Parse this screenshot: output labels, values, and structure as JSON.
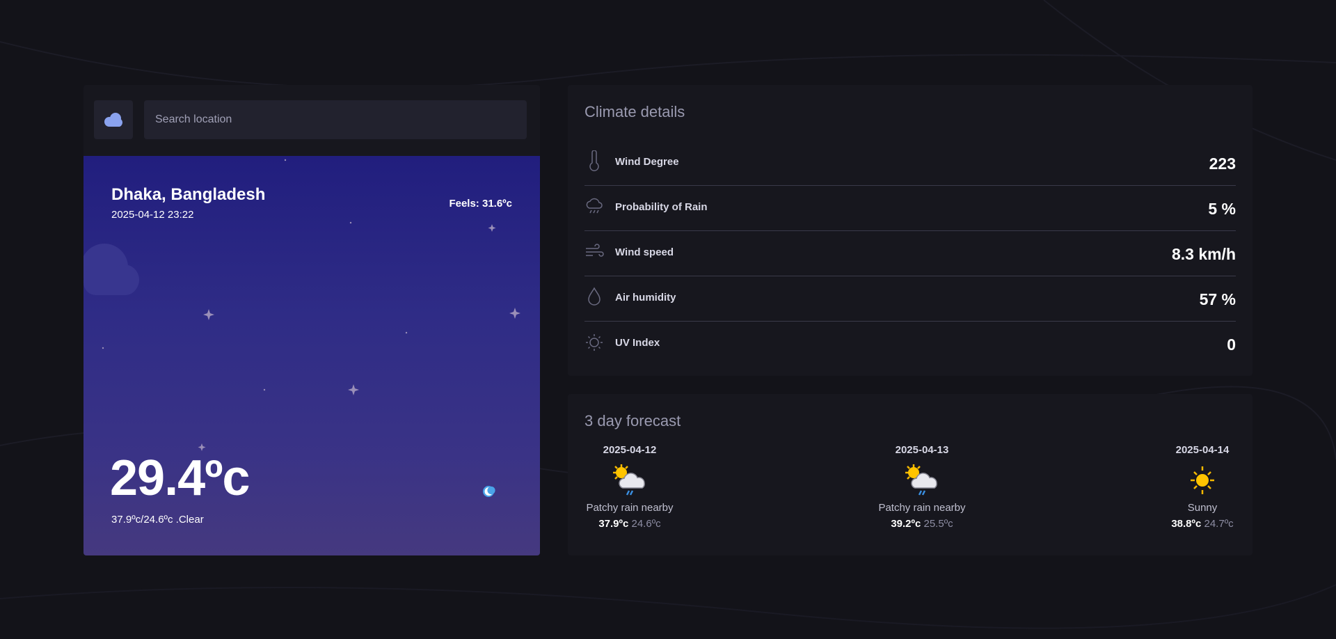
{
  "search": {
    "placeholder": "Search location",
    "logo_icon": "cloud-icon"
  },
  "current": {
    "city": "Dhaka, Bangladesh",
    "datetime": "2025-04-12 23:22",
    "feels": "Feels: 31.6ºc",
    "temp": "29.4ºc",
    "range": "37.9ºc/24.6ºc .Clear",
    "icon": "moon-icon"
  },
  "climate": {
    "title": "Climate details",
    "items": [
      {
        "label": "Wind Degree",
        "value": "223",
        "icon": "thermometer-icon"
      },
      {
        "label": "Probability of Rain",
        "value": "5 %",
        "icon": "rain-cloud-icon"
      },
      {
        "label": "Wind speed",
        "value": "8.3 km/h",
        "icon": "wind-icon"
      },
      {
        "label": "Air humidity",
        "value": "57 %",
        "icon": "droplet-icon"
      },
      {
        "label": "UV Index",
        "value": "0",
        "icon": "sun-icon"
      }
    ]
  },
  "forecast": {
    "title": "3 day forecast",
    "days": [
      {
        "date": "2025-04-12",
        "condition": "Patchy rain nearby",
        "max": "37.9ºc",
        "min": "24.6ºc",
        "icon": "patchy-rain-icon"
      },
      {
        "date": "2025-04-13",
        "condition": "Patchy rain nearby",
        "max": "39.2ºc",
        "min": "25.5ºc",
        "icon": "patchy-rain-icon"
      },
      {
        "date": "2025-04-14",
        "condition": "Sunny",
        "max": "38.8ºc",
        "min": "24.7ºc",
        "icon": "sunny-icon"
      }
    ]
  },
  "colors": {
    "background": "#131319",
    "panel": "#17171e",
    "card_top": "#211e7e",
    "card_bottom": "#45397f"
  }
}
